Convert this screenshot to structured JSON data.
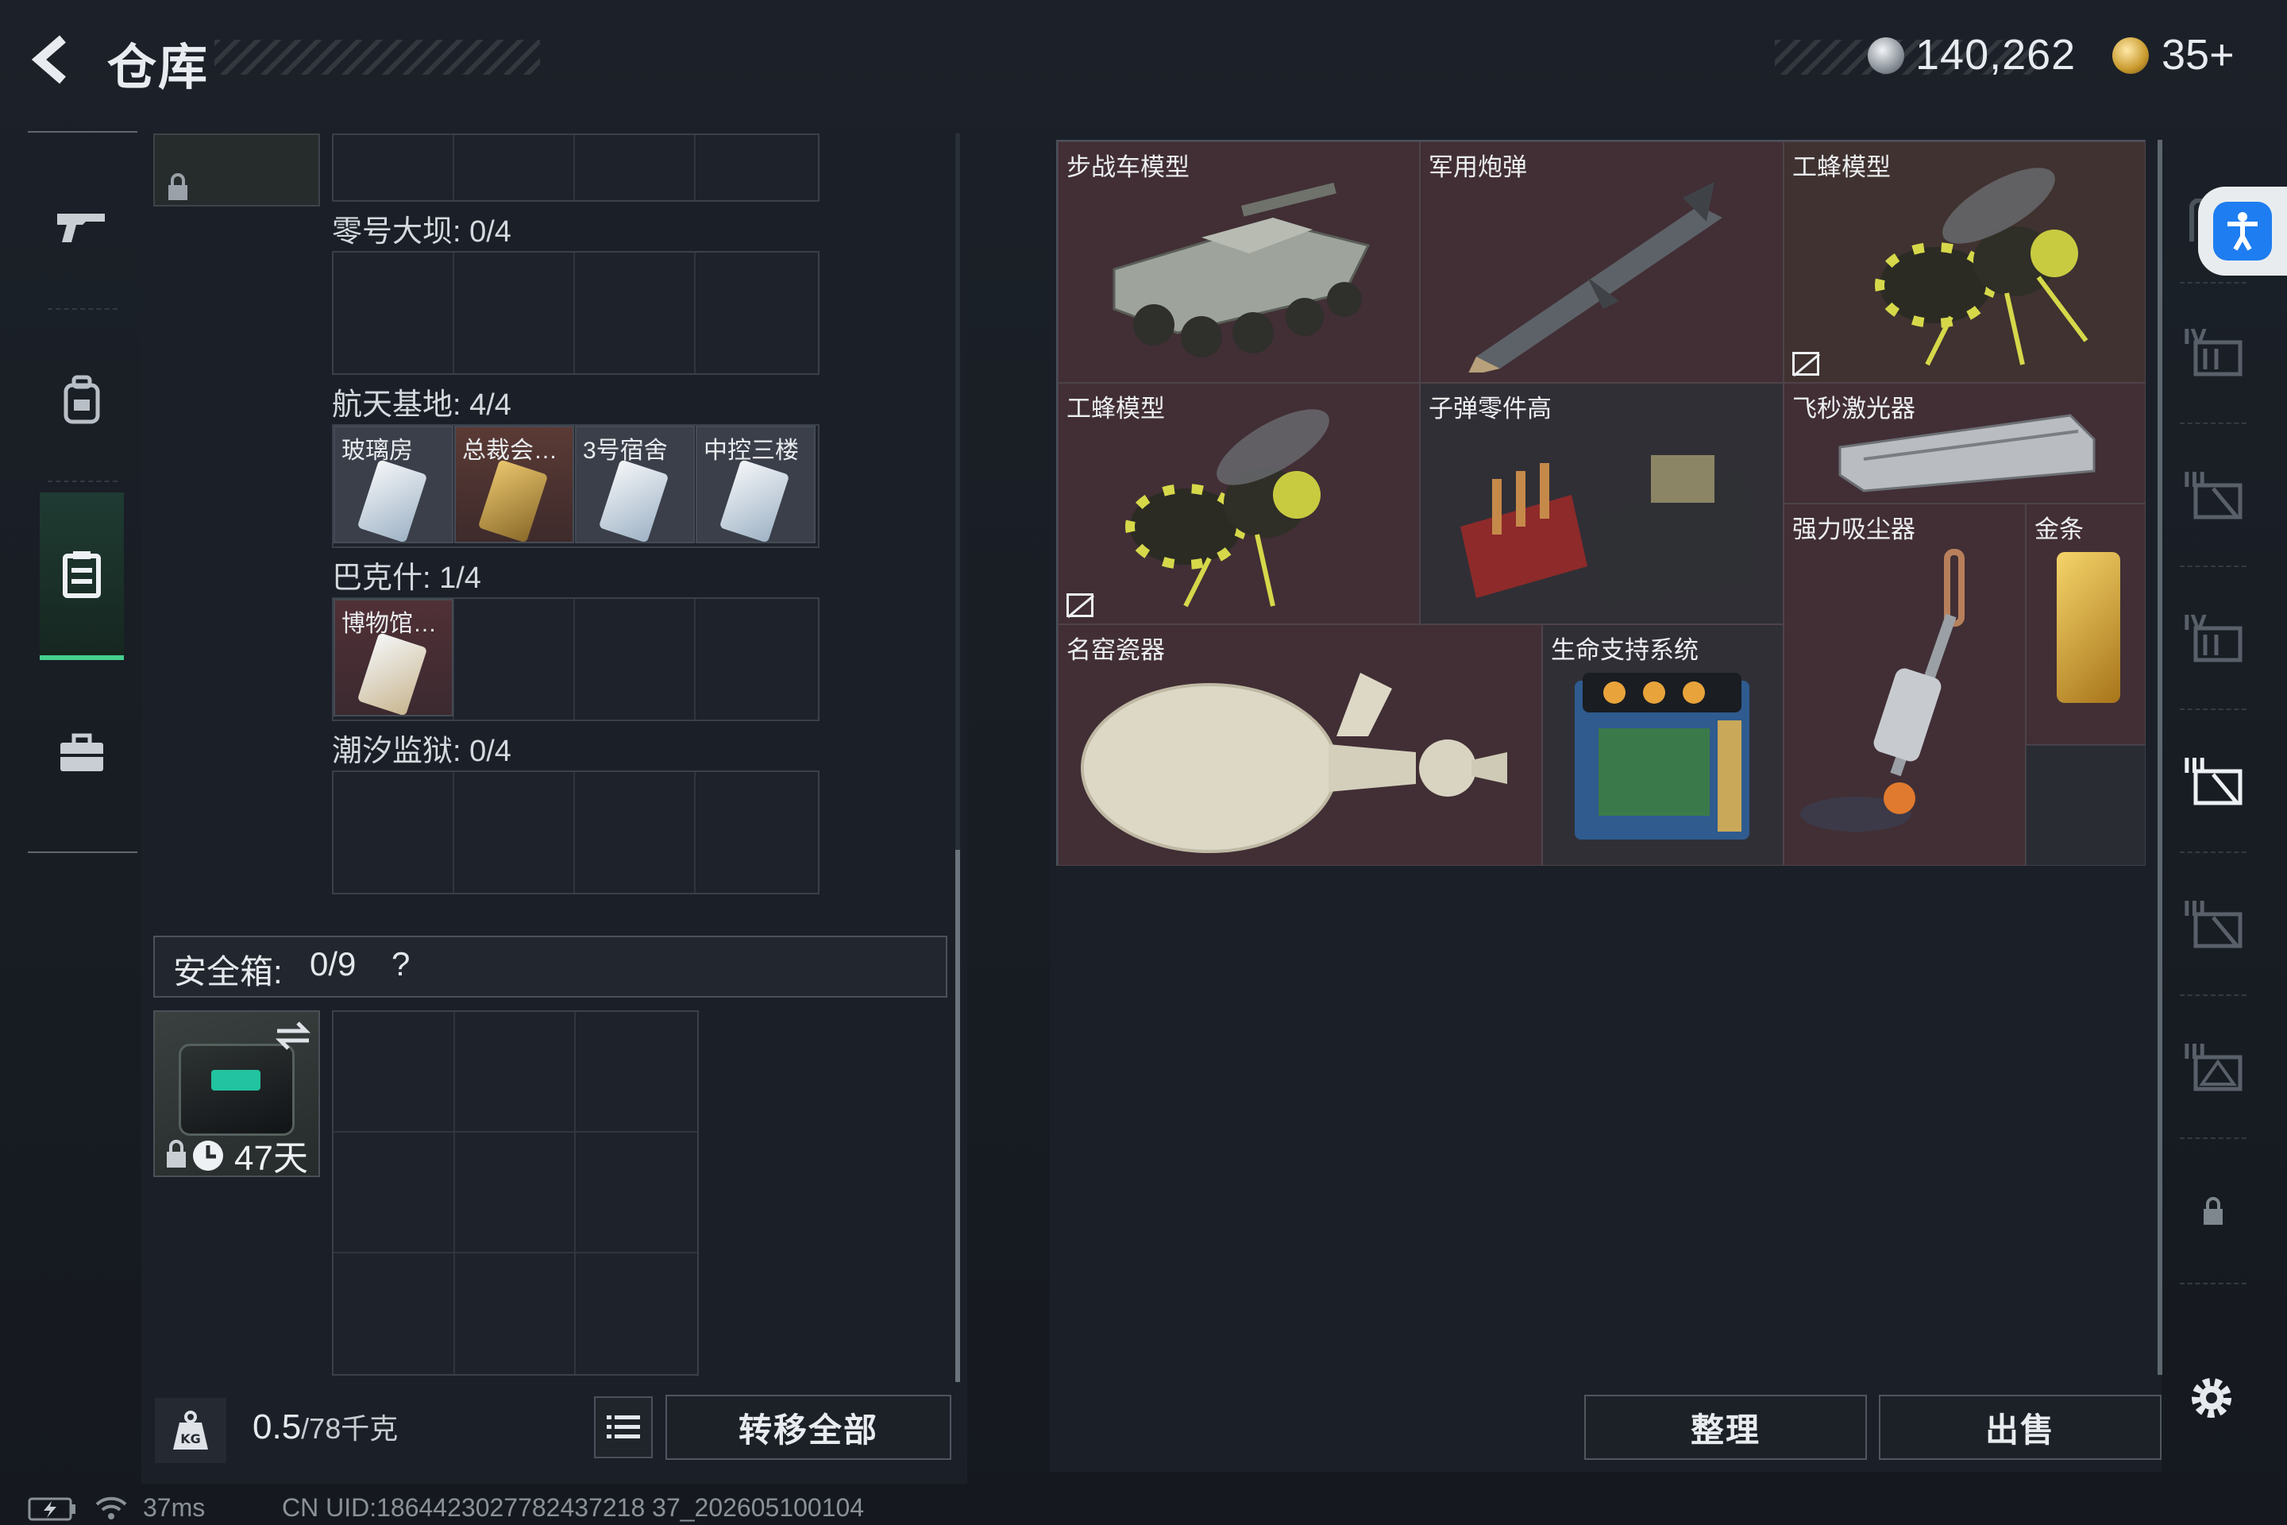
{
  "header": {
    "title": "仓库",
    "currency_1": "140,262",
    "currency_2": "35+",
    "mini": "ⅢⅢ ⅡⅡ"
  },
  "left_rail": {
    "items": [
      {
        "name": "weapons",
        "icon": "gun-icon"
      },
      {
        "name": "backpack",
        "icon": "backpack-icon"
      },
      {
        "name": "container",
        "icon": "container-icon",
        "active": true
      },
      {
        "name": "toolbox",
        "icon": "briefcase-icon"
      }
    ]
  },
  "collections": [
    {
      "label": "零号大坝: 0/4",
      "cards": []
    },
    {
      "label": "航天基地: 4/4",
      "cards": [
        "玻璃房",
        "总裁会…",
        "3号宿舍",
        "中控三楼"
      ]
    },
    {
      "label": "巴克什: 1/4",
      "cards": [
        "博物馆…"
      ]
    },
    {
      "label": "潮汐监狱: 0/4",
      "cards": []
    }
  ],
  "safe_box": {
    "label": "安全箱:",
    "count": "0/9",
    "help": "?",
    "days": "47天"
  },
  "capacity": {
    "current": "0.5",
    "max": "/78千克"
  },
  "buttons": {
    "transfer_all": "转移全部",
    "sort": "整理",
    "sell": "出售"
  },
  "inventory": [
    {
      "name": "步战车模型"
    },
    {
      "name": "军用炮弹"
    },
    {
      "name": "工蜂模型"
    },
    {
      "name": "工蜂模型"
    },
    {
      "name": "子弹零件高"
    },
    {
      "name": "飞秒激光器"
    },
    {
      "name": "强力吸尘器"
    },
    {
      "name": "金条"
    },
    {
      "name": "名窑瓷器"
    },
    {
      "name": "生命支持系统"
    }
  ],
  "status_bar": {
    "ping": "37ms",
    "uid": "CN UID:1864423027782437218 37_202605100104"
  },
  "colors": {
    "accent_green": "#46d18e",
    "item_red": "#412f35",
    "panel": "#1b2028",
    "access_blue": "#1e7df0"
  }
}
